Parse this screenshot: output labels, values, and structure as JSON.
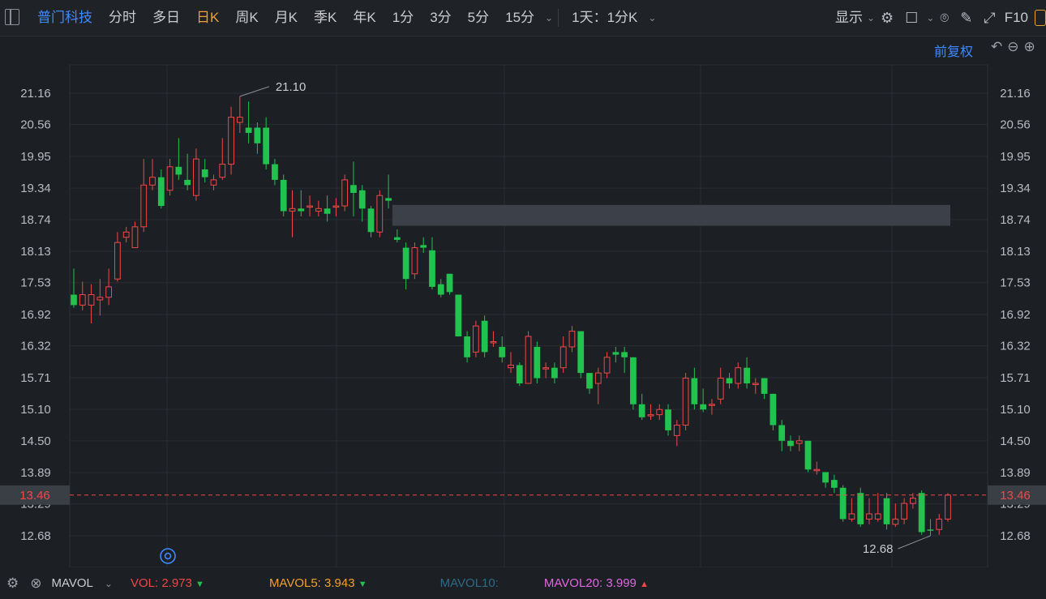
{
  "toolbar": {
    "stock_name": "普门科技",
    "periods": [
      "分时",
      "多日",
      "日K",
      "周K",
      "月K",
      "季K",
      "年K",
      "1分",
      "3分",
      "5分",
      "15分"
    ],
    "active_period": "日K",
    "interval_select": "1天：1分K",
    "display_label": "显示",
    "f10_label": "F10"
  },
  "adjust_label": "前复权",
  "colors": {
    "up": "#f04848",
    "down": "#22c24e",
    "current": "#f04848",
    "background": "#1c1f24"
  },
  "chart_data": {
    "type": "candlestick",
    "yaxis_ticks": [
      21.16,
      20.56,
      19.95,
      19.34,
      18.74,
      18.13,
      17.53,
      16.92,
      16.32,
      15.71,
      15.1,
      14.5,
      13.89,
      13.29,
      12.68
    ],
    "ylim": [
      12.68,
      21.16
    ],
    "current_price": 13.46,
    "current_price_label": "13.46",
    "high_label": "21.10",
    "low_label": "12.68",
    "highlight_band": {
      "low": 18.62,
      "high": 19.02
    },
    "candles": [
      [
        17.3,
        17.1,
        17.8,
        17.05
      ],
      [
        17.1,
        17.3,
        17.55,
        17.0
      ],
      [
        17.1,
        17.3,
        17.5,
        16.75
      ],
      [
        17.2,
        17.25,
        17.6,
        16.9
      ],
      [
        17.25,
        17.45,
        17.8,
        17.1
      ],
      [
        17.6,
        18.3,
        18.5,
        17.55
      ],
      [
        18.4,
        18.5,
        18.6,
        18.3
      ],
      [
        18.2,
        18.6,
        18.7,
        18.2
      ],
      [
        18.6,
        19.4,
        19.9,
        18.5
      ],
      [
        19.4,
        19.55,
        19.9,
        19.3
      ],
      [
        19.55,
        19.0,
        19.7,
        18.95
      ],
      [
        19.3,
        19.75,
        19.9,
        19.2
      ],
      [
        19.75,
        19.6,
        20.3,
        19.5
      ],
      [
        19.5,
        19.4,
        20.0,
        19.3
      ],
      [
        19.2,
        19.9,
        20.1,
        19.1
      ],
      [
        19.7,
        19.55,
        19.9,
        19.45
      ],
      [
        19.4,
        19.5,
        19.6,
        19.3
      ],
      [
        19.55,
        19.8,
        20.3,
        19.5
      ],
      [
        19.8,
        20.7,
        20.9,
        19.6
      ],
      [
        20.6,
        20.7,
        21.1,
        20.4
      ],
      [
        20.5,
        20.4,
        21.0,
        20.2
      ],
      [
        20.5,
        20.2,
        20.6,
        20.0
      ],
      [
        20.5,
        19.8,
        20.7,
        19.7
      ],
      [
        19.8,
        19.5,
        19.9,
        19.4
      ],
      [
        19.5,
        18.9,
        19.6,
        18.8
      ],
      [
        18.9,
        18.95,
        19.3,
        18.4
      ],
      [
        18.95,
        18.9,
        19.3,
        18.8
      ],
      [
        19.0,
        19.0,
        19.2,
        18.8
      ],
      [
        18.9,
        18.95,
        19.1,
        18.8
      ],
      [
        18.95,
        18.85,
        19.2,
        18.7
      ],
      [
        19.0,
        19.0,
        19.15,
        18.8
      ],
      [
        19.0,
        19.5,
        19.6,
        18.9
      ],
      [
        19.4,
        19.25,
        19.85,
        18.8
      ],
      [
        19.3,
        18.95,
        19.4,
        18.7
      ],
      [
        18.95,
        18.5,
        19.0,
        18.4
      ],
      [
        18.5,
        19.2,
        19.3,
        18.4
      ],
      [
        19.15,
        19.1,
        19.6,
        18.95
      ],
      [
        18.4,
        18.35,
        18.55,
        18.3
      ],
      [
        18.2,
        17.6,
        18.3,
        17.4
      ],
      [
        17.7,
        18.2,
        18.3,
        17.6
      ],
      [
        18.25,
        18.2,
        18.4,
        18.1
      ],
      [
        18.15,
        17.45,
        18.4,
        17.4
      ],
      [
        17.5,
        17.3,
        17.6,
        17.25
      ],
      [
        17.7,
        17.35,
        17.7,
        17.3
      ],
      [
        17.3,
        16.5,
        17.3,
        16.5
      ],
      [
        16.5,
        16.1,
        16.6,
        16.0
      ],
      [
        16.2,
        16.7,
        16.8,
        16.1
      ],
      [
        16.8,
        16.2,
        16.9,
        16.1
      ],
      [
        16.4,
        16.4,
        16.6,
        16.3
      ],
      [
        16.3,
        16.1,
        16.5,
        16.0
      ],
      [
        15.9,
        15.95,
        16.2,
        15.8
      ],
      [
        15.95,
        15.6,
        16.0,
        15.55
      ],
      [
        15.6,
        16.5,
        16.6,
        15.6
      ],
      [
        16.3,
        15.7,
        16.4,
        15.6
      ],
      [
        15.9,
        15.9,
        16.0,
        15.7
      ],
      [
        15.9,
        15.7,
        16.0,
        15.6
      ],
      [
        15.9,
        16.3,
        16.5,
        15.8
      ],
      [
        16.3,
        16.6,
        16.7,
        16.2
      ],
      [
        16.6,
        15.8,
        16.6,
        15.7
      ],
      [
        15.8,
        15.5,
        15.8,
        15.4
      ],
      [
        15.6,
        15.8,
        15.9,
        15.2
      ],
      [
        15.8,
        16.1,
        16.2,
        15.7
      ],
      [
        16.2,
        16.15,
        16.3,
        16.0
      ],
      [
        16.2,
        16.1,
        16.3,
        15.8
      ],
      [
        16.1,
        15.2,
        16.1,
        15.1
      ],
      [
        15.2,
        14.95,
        15.4,
        14.9
      ],
      [
        15.0,
        15.0,
        15.2,
        14.9
      ],
      [
        15.0,
        15.1,
        15.2,
        14.9
      ],
      [
        15.1,
        14.7,
        15.2,
        14.6
      ],
      [
        14.6,
        14.8,
        14.9,
        14.4
      ],
      [
        14.8,
        15.7,
        15.8,
        14.7
      ],
      [
        15.7,
        15.2,
        15.9,
        15.1
      ],
      [
        15.2,
        15.1,
        15.5,
        15.05
      ],
      [
        15.2,
        15.2,
        15.3,
        15.0
      ],
      [
        15.3,
        15.7,
        15.9,
        15.2
      ],
      [
        15.7,
        15.6,
        15.8,
        15.5
      ],
      [
        15.6,
        15.9,
        16.0,
        15.5
      ],
      [
        15.9,
        15.6,
        16.1,
        15.5
      ],
      [
        15.6,
        15.6,
        15.7,
        15.4
      ],
      [
        15.7,
        15.4,
        15.7,
        15.3
      ],
      [
        15.4,
        14.8,
        15.4,
        14.7
      ],
      [
        14.8,
        14.5,
        14.9,
        14.3
      ],
      [
        14.5,
        14.4,
        14.6,
        14.3
      ],
      [
        14.45,
        14.5,
        14.6,
        14.3
      ],
      [
        14.5,
        13.95,
        14.5,
        13.9
      ],
      [
        13.95,
        13.95,
        14.1,
        13.85
      ],
      [
        13.9,
        13.7,
        13.9,
        13.6
      ],
      [
        13.75,
        13.6,
        13.85,
        13.5
      ],
      [
        13.6,
        13.0,
        13.65,
        12.95
      ],
      [
        13.0,
        13.1,
        13.4,
        12.95
      ],
      [
        13.5,
        12.9,
        13.6,
        12.85
      ],
      [
        13.0,
        13.1,
        13.4,
        12.9
      ],
      [
        13.0,
        13.1,
        13.5,
        12.95
      ],
      [
        13.4,
        12.9,
        13.5,
        12.8
      ],
      [
        12.9,
        13.0,
        13.3,
        12.85
      ],
      [
        13.0,
        13.3,
        13.4,
        12.9
      ],
      [
        13.3,
        13.4,
        13.5,
        13.2
      ],
      [
        13.5,
        12.75,
        13.55,
        12.7
      ],
      [
        12.8,
        12.78,
        13.0,
        12.68
      ],
      [
        12.8,
        13.0,
        13.1,
        12.7
      ],
      [
        13.0,
        13.46,
        13.5,
        12.95
      ]
    ]
  },
  "indicator": {
    "name": "MAVOL",
    "vol_label": "VOL:",
    "vol_value": "2.973",
    "mavol5_label": "MAVOL5:",
    "mavol5_value": "3.943",
    "mavol10_label": "MAVOL10:",
    "mavol20_label": "MAVOL20:",
    "mavol20_value": "3.999"
  }
}
